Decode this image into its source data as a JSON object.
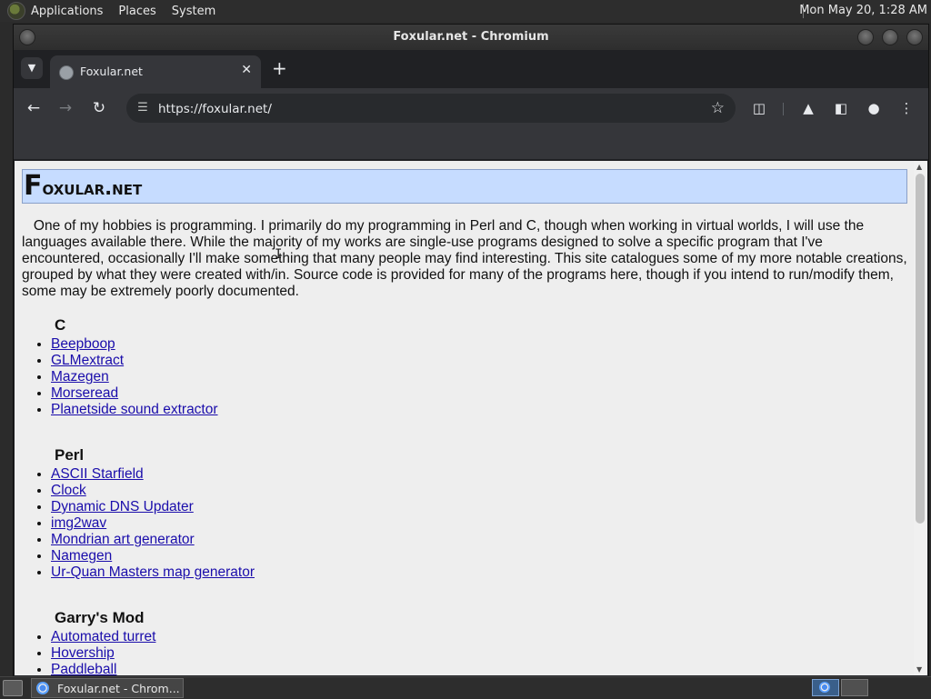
{
  "top_panel": {
    "menus": [
      "Applications",
      "Places",
      "System"
    ],
    "clock": "Mon May 20,  1:28 AM"
  },
  "window": {
    "title": "Foxular.net - Chromium"
  },
  "browser": {
    "tab": {
      "title": "Foxular.net",
      "close": "✕"
    },
    "new_tab": "+",
    "url": "https://foxular.net/"
  },
  "page": {
    "title_first": "F",
    "title_rest": "oxular.net",
    "intro": "One of my hobbies is programming. I primarily do my programming in Perl and C, though when working in virtual worlds, I will use the languages available there. While the majority of my works are single-use programs designed to solve a specific program that I've encountered, occasionally I'll make something that many people may find interesting. This site catalogues some of my more notable creations, grouped by what they were created with/in. Source code is provided for many of the programs here, though if you intend to run/modify them, some may be extremely poorly documented.",
    "sections": [
      {
        "title": "C",
        "links": [
          "Beepboop",
          "GLMextract",
          "Mazegen",
          "Morseread",
          "Planetside sound extractor"
        ]
      },
      {
        "title": "Perl",
        "links": [
          "ASCII Starfield",
          "Clock",
          "Dynamic DNS Updater",
          "img2wav",
          "Mondrian art generator",
          "Namegen",
          "Ur-Quan Masters map generator"
        ]
      },
      {
        "title": "Garry's Mod",
        "links": [
          "Automated turret",
          "Hovership",
          "Paddleball"
        ]
      }
    ]
  },
  "taskbar": {
    "task_label": "Foxular.net - Chrom..."
  },
  "icons": {
    "back": "arrow-left-icon",
    "forward": "arrow-right-icon",
    "reload": "reload-icon",
    "site_info": "tune-icon",
    "star": "star-icon",
    "extensions": "puzzle-icon",
    "labs": "flask-icon",
    "side_panel": "side-panel-icon",
    "profile": "profile-icon",
    "menu": "kebab-menu-icon"
  },
  "colors": {
    "title_bg": "#c6dcff",
    "link": "#1a0dab",
    "page_bg": "#eeeeee",
    "browser_chrome": "#35363a"
  }
}
